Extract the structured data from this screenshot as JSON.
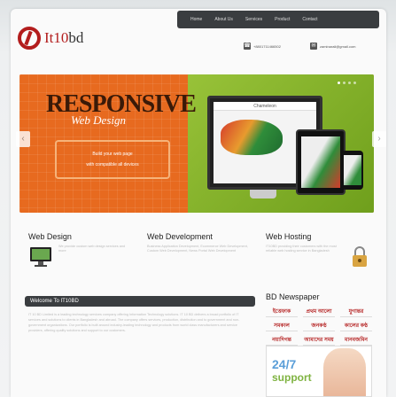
{
  "nav": {
    "items": [
      "Home",
      "About Us",
      "Services",
      "Product",
      "Contact"
    ]
  },
  "logo": {
    "brand": "It",
    "brand_accent": "10",
    "brand_tail": "bd"
  },
  "contact": {
    "phone": "+8801711466502",
    "email": "zaminarali@gmail.com"
  },
  "slider": {
    "headline": "RESPONSIVE",
    "subhead": "Web Design",
    "note_line1": "Build your web page",
    "note_line2": "with compatible all devices",
    "screen_title": "Chameleon",
    "prev": "‹",
    "next": "›"
  },
  "services": [
    {
      "title": "Web Design",
      "text": "We provide custom web design services and more"
    },
    {
      "title": "Web Development",
      "text": "Business Application Development, Ecommerce Web Development, Custom Web Development, News Portal Web Development"
    },
    {
      "title": "Web Hosting",
      "text": "IT10BD providing their customers with the most reliable web hosting service in Bangladesh"
    }
  ],
  "welcome": {
    "title": "Welcome To IT10BD",
    "text": "IT 10 BD Limited is a leading technology services company offering Information Technology solutions. IT 10 BD delivers a broad portfolio of IT services and solutions to clients in Bangladesh and abroad. The company offers services, production, distribution and to government and non-government organizations. Our portfolio is built around industry-leading technology and products from world class manufacturers and service providers, offering quality solutions and support to our customers."
  },
  "news": {
    "title": "BD Newspaper",
    "papers": [
      "ইত্তেফাক",
      "প্রথম আলো",
      "যুগান্তর",
      "সমকাল",
      "জনকণ্ঠ",
      "কালের কণ্ঠ",
      "নয়াদিগন্ত",
      "আমাদের সময়",
      "মানবজমিন"
    ]
  },
  "support": {
    "hours": "24/7",
    "label": "support"
  },
  "colors": {
    "accent": "#b31d1d",
    "slider_orange": "#e76a1f",
    "slider_green": "#8bb832",
    "dark_bar": "#3a3d40"
  }
}
